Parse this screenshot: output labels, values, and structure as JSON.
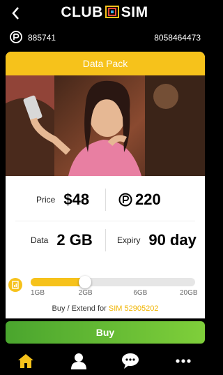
{
  "header": {
    "back_icon": "chevron-left-icon",
    "logo_left": "CLUB",
    "logo_right": "SIM",
    "logo_mark_color": "#f6c21b"
  },
  "account": {
    "badge_icon": "points-badge-icon",
    "left_number": "885741",
    "right_number": "8058464473"
  },
  "pack": {
    "title": "Data Pack",
    "price_label": "Price",
    "price_value": "$48",
    "points_value": "220",
    "data_label": "Data",
    "data_value": "2 GB",
    "expiry_label": "Expiry",
    "expiry_value": "90 day"
  },
  "selector": {
    "icon": "data-usage-icon",
    "options": [
      "1GB",
      "2GB",
      "6GB",
      "20GB"
    ],
    "selected_fraction": 0.33
  },
  "extend": {
    "text": "Buy / Extend for ",
    "sim_text": "SIM 52905202"
  },
  "buy_label": "Buy",
  "nav": {
    "items": [
      "home-icon",
      "profile-icon",
      "chat-icon",
      "more-icon"
    ],
    "active_color": "#f6c21b"
  },
  "colors": {
    "accent": "#f6c21b",
    "buy_green": "#4aa52e"
  }
}
